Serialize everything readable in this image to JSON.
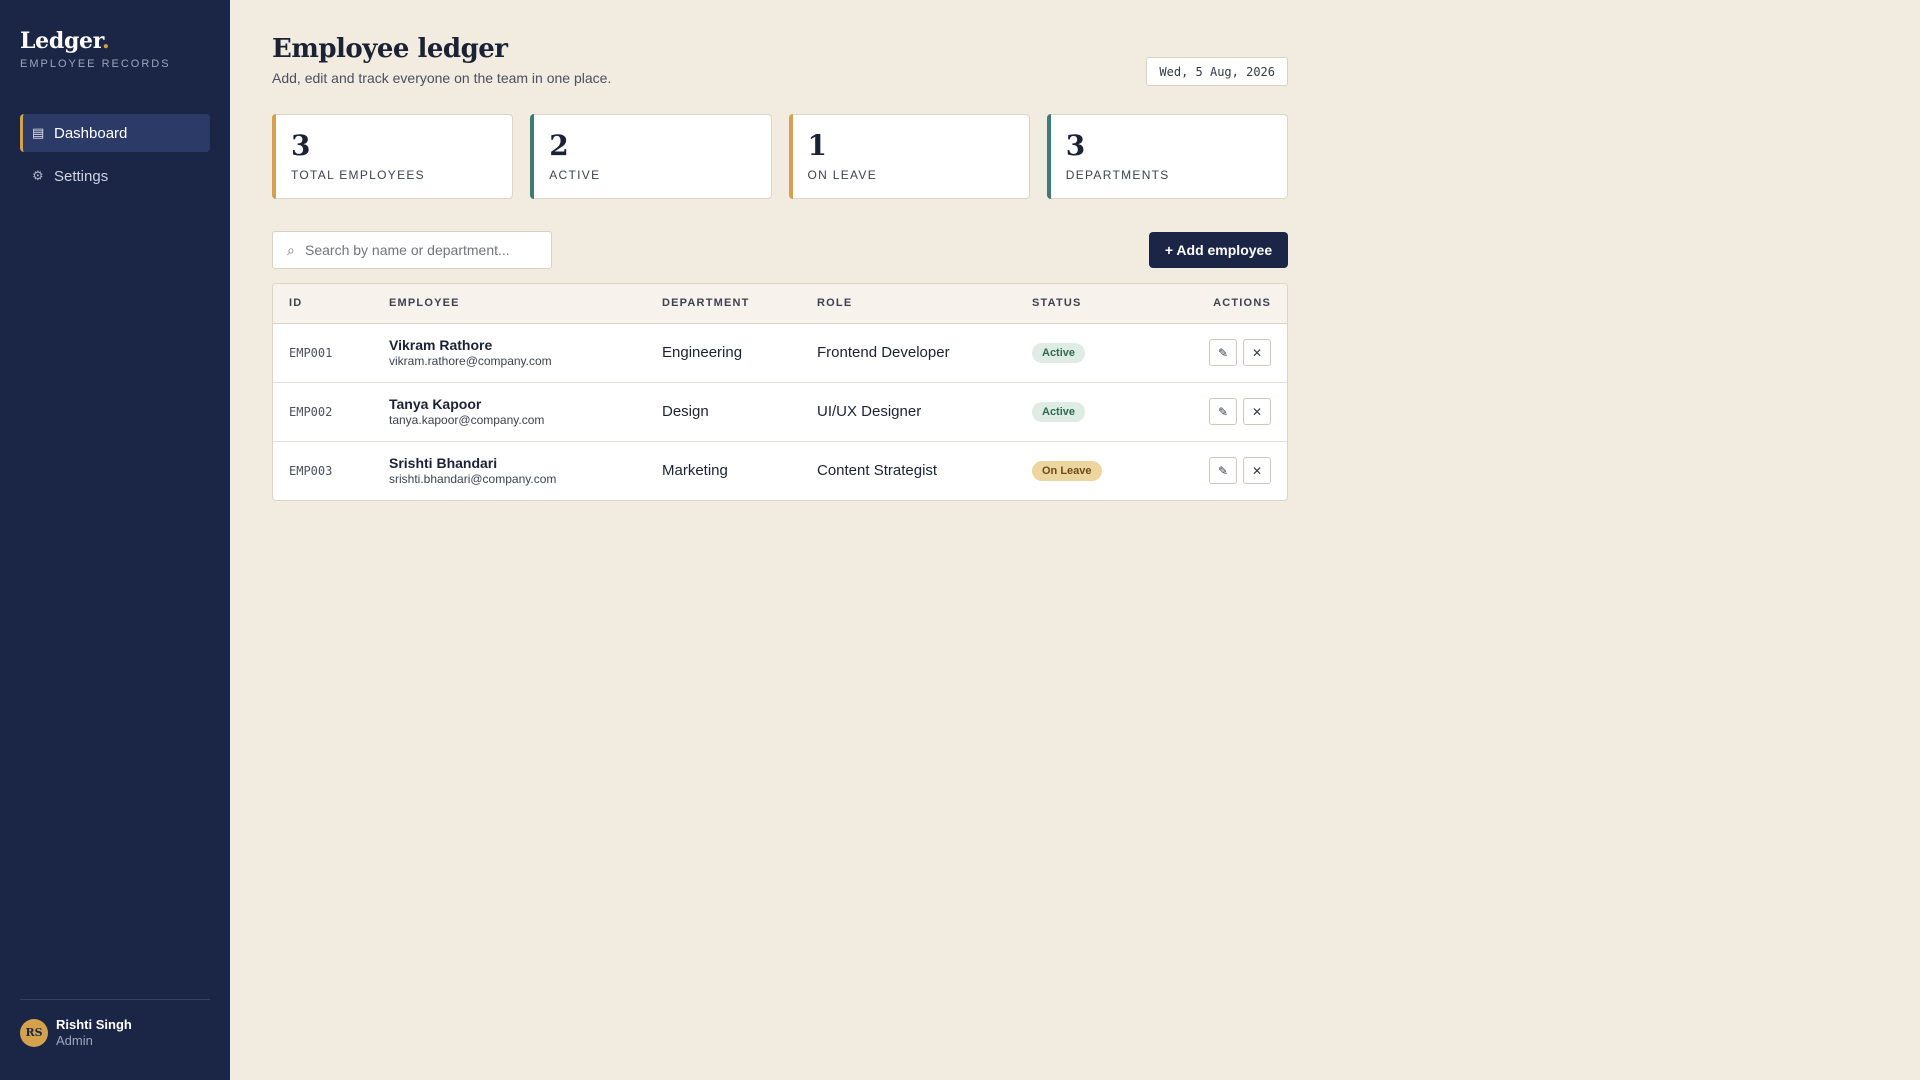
{
  "sidebar": {
    "brand": "Ledger",
    "brand_dot": ".",
    "brand_sub": "EMPLOYEE RECORDS",
    "nav": [
      {
        "label": "Dashboard",
        "icon": "grid-icon",
        "glyph": "▤",
        "active": true
      },
      {
        "label": "Settings",
        "icon": "gear-icon",
        "glyph": "⚙",
        "active": false
      }
    ],
    "user": {
      "initials": "RS",
      "name": "Rishti Singh",
      "role": "Admin"
    }
  },
  "header": {
    "title": "Employee ledger",
    "subtitle": "Add, edit and track everyone on the team in one place.",
    "date": "Wed, 5 Aug, 2026"
  },
  "stats": [
    {
      "value": "3",
      "label": "TOTAL EMPLOYEES",
      "accent": "#d4a24c"
    },
    {
      "value": "2",
      "label": "ACTIVE",
      "accent": "#3d7c74"
    },
    {
      "value": "1",
      "label": "ON LEAVE",
      "accent": "#d4a24c"
    },
    {
      "value": "3",
      "label": "DEPARTMENTS",
      "accent": "#3d7c74"
    }
  ],
  "toolbar": {
    "search_placeholder": "Search by name or department...",
    "search_icon": "search-icon",
    "add_label": "+ Add employee"
  },
  "table": {
    "headers": {
      "id": "ID",
      "employee": "EMPLOYEE",
      "department": "DEPARTMENT",
      "role": "ROLE",
      "status": "STATUS",
      "actions": "ACTIONS"
    },
    "rows": [
      {
        "id": "EMP001",
        "name": "Vikram Rathore",
        "email": "vikram.rathore@company.com",
        "department": "Engineering",
        "role": "Frontend Developer",
        "status": "Active",
        "status_kind": "active"
      },
      {
        "id": "EMP002",
        "name": "Tanya Kapoor",
        "email": "tanya.kapoor@company.com",
        "department": "Design",
        "role": "UI/UX Designer",
        "status": "Active",
        "status_kind": "active"
      },
      {
        "id": "EMP003",
        "name": "Srishti Bhandari",
        "email": "srishti.bhandari@company.com",
        "department": "Marketing",
        "role": "Content Strategist",
        "status": "On Leave",
        "status_kind": "leave"
      }
    ],
    "edit_glyph": "✎",
    "delete_glyph": "✕"
  },
  "colors": {
    "sidebar_bg": "#1b2545",
    "page_bg": "#f1ebe0",
    "accent_gold": "#d4a24c",
    "accent_teal": "#3d7c74",
    "button_primary": "#1b2545"
  }
}
